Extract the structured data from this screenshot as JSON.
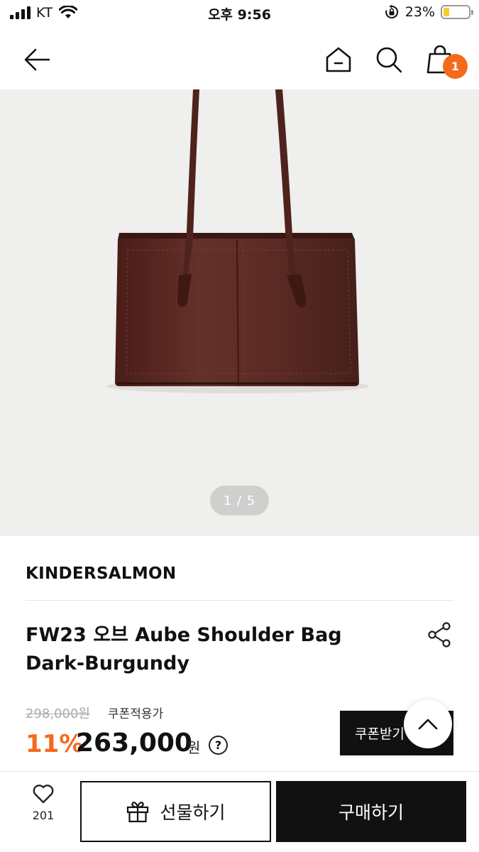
{
  "status_bar": {
    "carrier": "KT",
    "time": "오후 9:56",
    "battery_percent": "23%",
    "battery_level": 0.23
  },
  "nav": {
    "cart_count": "1",
    "icons": [
      "back-arrow-icon",
      "home-icon",
      "search-icon",
      "shopping-bag-icon"
    ]
  },
  "gallery": {
    "page_indicator": "1 / 5",
    "current_page": 1,
    "total_pages": 5,
    "background_color": "#efefed",
    "bag_color": "#5a2620"
  },
  "product": {
    "brand": "KINDERSALMON",
    "name_line1": "FW23 오브 Aube Shoulder Bag",
    "name_line2": "Dark-Burgundy",
    "original_price": "298,000원",
    "coupon_label": "쿠폰적용가",
    "discount": "11%",
    "sale_price": "263,000",
    "currency": "원",
    "help_label": "?",
    "coupon_button": "쿠폰받기"
  },
  "bottom_bar": {
    "like_count": "201",
    "gift_label": "선물하기",
    "buy_label": "구매하기"
  },
  "colors": {
    "accent": "#f46a1d",
    "primary_button": "#111111"
  }
}
